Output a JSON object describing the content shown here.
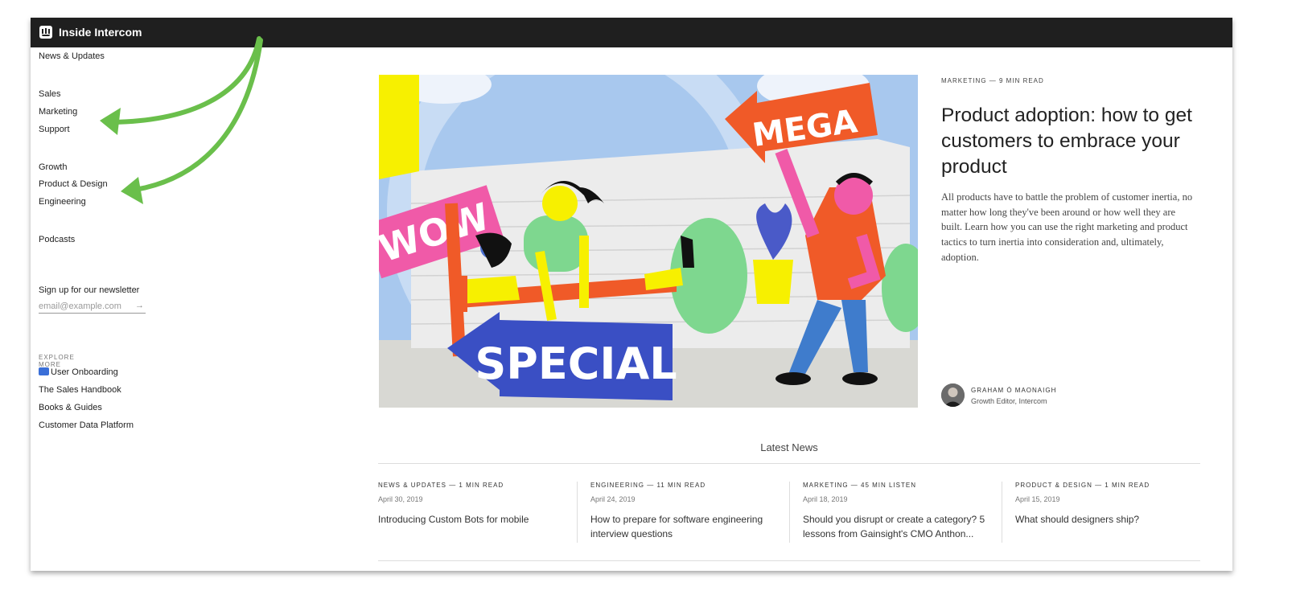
{
  "header": {
    "title": "Inside Intercom",
    "logo_icon": "intercom-logo-icon"
  },
  "sidebar": {
    "primary": "News & Updates",
    "groups": [
      [
        "Sales",
        "Marketing",
        "Support"
      ],
      [
        "Growth",
        "Product & Design",
        "Engineering"
      ],
      [
        "Podcasts"
      ]
    ],
    "newsletter": {
      "label": "Sign up for our newsletter",
      "placeholder": "email@example.com",
      "submit_icon": "arrow-right-icon",
      "submit_glyph": "→"
    },
    "explore": {
      "label": "EXPLORE MORE",
      "links": [
        "User Onboarding",
        "The Sales Handbook",
        "Books & Guides",
        "Customer Data Platform"
      ]
    }
  },
  "hero": {
    "category": "MARKETING — 9 MIN READ",
    "title": "Product adoption: how to get customers to embrace your product",
    "excerpt": "All products have to battle the problem of customer inertia, no matter how long they've been around or how well they are built. Learn how you can use the right marketing and product tactics to turn inertia into consideration and, ultimately, adoption.",
    "author": {
      "name": "GRAHAM Ó MAONAIGH",
      "role": "Growth Editor, Intercom"
    },
    "illustration_text": {
      "wow": "WOW",
      "mega": "MEGA",
      "special": "SPECIAL"
    }
  },
  "latest": {
    "title": "Latest News",
    "articles": [
      {
        "category": "NEWS & UPDATES — 1 MIN READ",
        "date": "April 30, 2019",
        "title": "Introducing Custom Bots for mobile"
      },
      {
        "category": "ENGINEERING — 11 MIN READ",
        "date": "April 24, 2019",
        "title": "How to prepare for software engineering interview questions"
      },
      {
        "category": "MARKETING — 45 MIN LISTEN",
        "date": "April 18, 2019",
        "title": "Should you disrupt or create a category? 5 lessons from Gainsight's CMO Anthon..."
      },
      {
        "category": "PRODUCT & DESIGN — 1 MIN READ",
        "date": "April 15, 2019",
        "title": "What should designers ship?"
      }
    ]
  },
  "colors": {
    "topbar": "#1f1f1f",
    "annotation_arrow": "#6abf4b"
  }
}
